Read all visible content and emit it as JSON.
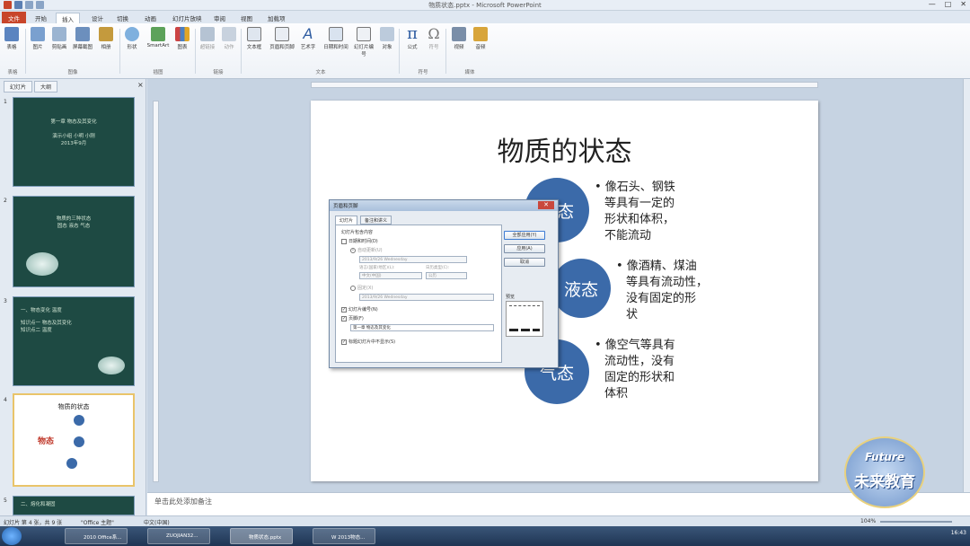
{
  "window": {
    "title": "物质状态.pptx - Microsoft PowerPoint",
    "controls": [
      "—",
      "□",
      "✕"
    ]
  },
  "tabs": {
    "file": "文件",
    "items": [
      "开始",
      "插入",
      "设计",
      "切换",
      "动画",
      "幻灯片放映",
      "审阅",
      "视图",
      "加载项"
    ],
    "active_index": 1
  },
  "ribbon": {
    "buttons": [
      "表格",
      "图片",
      "剪贴画",
      "屏幕截图",
      "相册",
      "形状",
      "SmartArt",
      "图表",
      "超链接",
      "动作",
      "文本框",
      "页眉和页脚",
      "艺术字",
      "日期和时间",
      "幻灯片编号",
      "对象",
      "公式",
      "符号",
      "视频",
      "音频"
    ],
    "groups": [
      "表格",
      "图像",
      "插图",
      "链接",
      "文本",
      "符号",
      "媒体"
    ]
  },
  "left_pane": {
    "tabs": [
      "幻灯片",
      "大纲"
    ],
    "thumbs": [
      {
        "num": "1",
        "lines": [
          "第一章  物态及其变化",
          "演示小组 小明 小刚",
          "2013年9月"
        ]
      },
      {
        "num": "2",
        "lines": [
          "物质的三种状态",
          "固态 液态 气态"
        ]
      },
      {
        "num": "3",
        "lines": [
          "一、物态变化  温度",
          "知识点一 物态及其变化",
          "知识点二 温度"
        ]
      },
      {
        "num": "4",
        "lines": [
          "物质的状态",
          "物态"
        ]
      },
      {
        "num": "5",
        "lines": [
          "二、熔化和凝固"
        ]
      }
    ]
  },
  "slide": {
    "title": "物质的状态",
    "states": [
      {
        "label": "固态",
        "bullet": [
          "• 像石头、钢铁",
          "等具有一定的",
          "形状和体积，",
          "不能流动"
        ]
      },
      {
        "label": "液态",
        "bullet": [
          "• 像酒精、煤油",
          "等具有流动性，",
          "没有固定的形",
          "状"
        ]
      },
      {
        "label": "气态",
        "bullet": [
          "• 像空气等具有",
          "流动性，没有",
          "固定的形状和",
          "体积"
        ]
      }
    ]
  },
  "dialog": {
    "title": "页眉和页脚",
    "close": "✕",
    "tabs": [
      "幻灯片",
      "备注和讲义"
    ],
    "section_label": "幻灯片包含内容",
    "date_label": "日期和时间(D)",
    "auto_update": "自动更新(U)",
    "date_value": "2013/9/26 Wednesday",
    "language_label": "语言(国家/地区)(L):",
    "calendar_label": "日历类型(C):",
    "language_value": "中文(中国)",
    "calendar_value": "公历",
    "fixed_label": "固定(X)",
    "fixed_value": "2013/9/26 Wednesday",
    "slide_number": "幻灯片编号(N)",
    "footer_label": "页脚(F)",
    "footer_value": "第一章 物态及其变化",
    "no_title": "标题幻灯片中不显示(S)",
    "preview_label": "预览",
    "buttons": [
      "全部应用(Y)",
      "应用(A)",
      "取消"
    ]
  },
  "notes": {
    "placeholder": "单击此处添加备注"
  },
  "status": {
    "left": "幻灯片 第 4 张，共 9 张",
    "theme": "\"Office 主题\"",
    "lang": "中文(中国)",
    "zoom": "104%"
  },
  "taskbar": {
    "items": [
      "2010 Office系...",
      "ZUOJIAN32...",
      "物质状态.pptx",
      "W 2013物态..."
    ],
    "clock": "16:43"
  },
  "logo": {
    "line1": "Future",
    "line2": "未来教育"
  }
}
